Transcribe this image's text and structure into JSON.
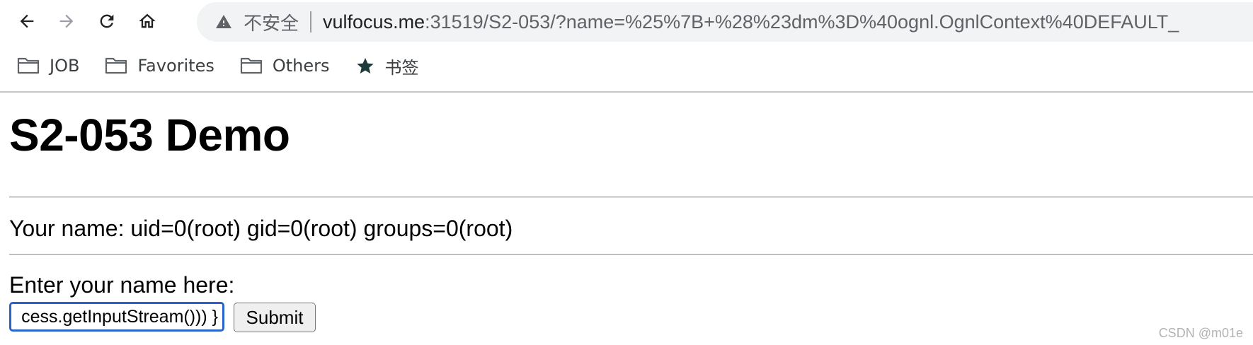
{
  "browser": {
    "nav": {
      "back_icon": "arrow-left-icon",
      "forward_icon": "arrow-right-icon",
      "reload_icon": "reload-icon",
      "home_icon": "home-icon"
    },
    "omnibox": {
      "security_icon": "warning-triangle-icon",
      "security_label": "不安全",
      "url_host": "vulfocus.me",
      "url_rest": ":31519/S2-053/?name=%25%7B+%28%23dm%3D%40ognl.OgnlContext%40DEFAULT_"
    },
    "bookmarks": [
      {
        "label": "JOB",
        "icon": "folder-icon"
      },
      {
        "label": "Favorites",
        "icon": "folder-icon"
      },
      {
        "label": "Others",
        "icon": "folder-icon"
      },
      {
        "label": "书签",
        "icon": "star-icon"
      }
    ]
  },
  "page": {
    "title": "S2-053 Demo",
    "result_text": "Your name: uid=0(root) gid=0(root) groups=0(root)",
    "prompt_label": "Enter your name here:",
    "name_input_value": "cess.getInputStream())) }",
    "submit_label": "Submit"
  },
  "watermark": "CSDN @m01e",
  "colors": {
    "focus_ring": "#2a64c9",
    "omnibox_bg": "#f1f3f4",
    "button_bg": "#efefef"
  }
}
